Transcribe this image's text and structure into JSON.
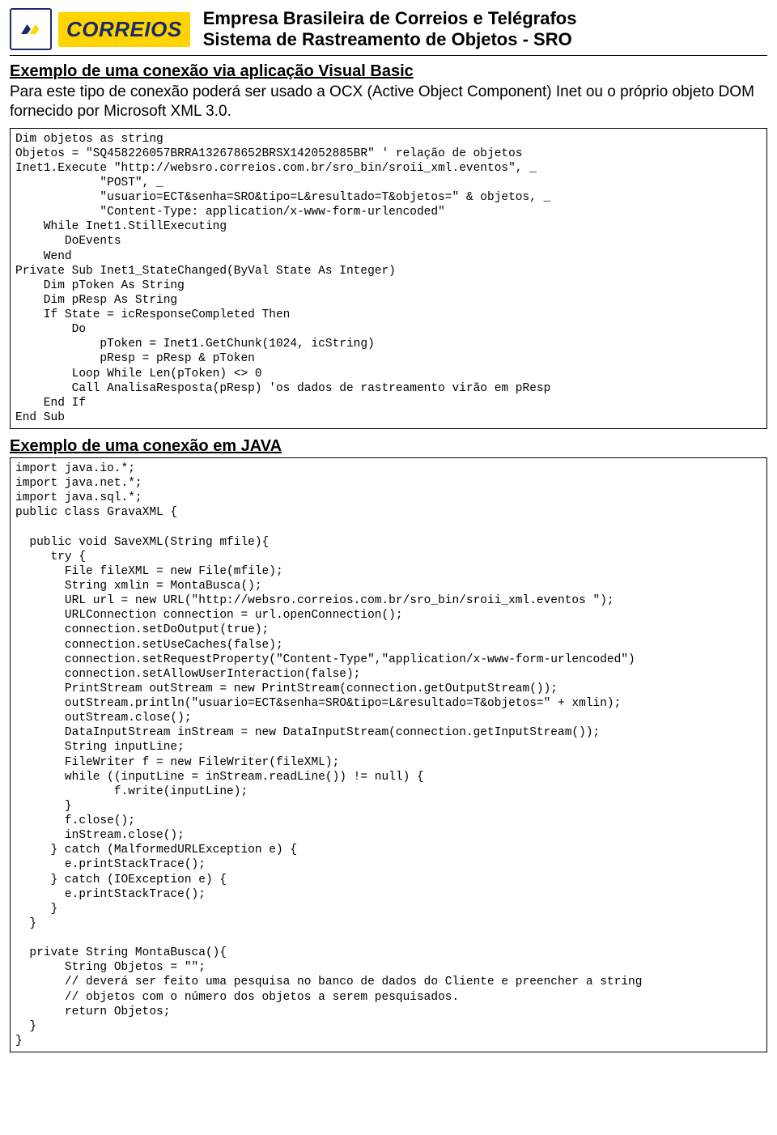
{
  "header": {
    "brand": "CORREIOS",
    "title1": "Empresa Brasileira de Correios e Telégrafos",
    "title2": "Sistema de Rastreamento de Objetos - SRO"
  },
  "section1": {
    "title": "Exemplo de uma conexão via aplicação Visual Basic",
    "intro": "Para este tipo de conexão poderá ser usado a OCX (Active Object Component) Inet ou o próprio objeto DOM fornecido por Microsoft XML 3.0.",
    "code": "Dim objetos as string\nObjetos = \"SQ458226057BRRA132678652BRSX142052885BR\" ' relação de objetos\nInet1.Execute \"http://websro.correios.com.br/sro_bin/sroii_xml.eventos\", _\n            \"POST\", _\n            \"usuario=ECT&senha=SRO&tipo=L&resultado=T&objetos=\" & objetos, _\n            \"Content-Type: application/x-www-form-urlencoded\"\n    While Inet1.StillExecuting\n       DoEvents\n    Wend\nPrivate Sub Inet1_StateChanged(ByVal State As Integer)\n    Dim pToken As String\n    Dim pResp As String\n    If State = icResponseCompleted Then\n        Do\n            pToken = Inet1.GetChunk(1024, icString)\n            pResp = pResp & pToken\n        Loop While Len(pToken) <> 0\n        Call AnalisaResposta(pResp) 'os dados de rastreamento virão em pResp\n    End If\nEnd Sub"
  },
  "section2": {
    "title": "Exemplo de uma conexão em JAVA",
    "code": "import java.io.*;\nimport java.net.*;\nimport java.sql.*;\npublic class GravaXML {\n\n  public void SaveXML(String mfile){\n     try {\n       File fileXML = new File(mfile);\n       String xmlin = MontaBusca();\n       URL url = new URL(\"http://websro.correios.com.br/sro_bin/sroii_xml.eventos \");\n       URLConnection connection = url.openConnection();\n       connection.setDoOutput(true);\n       connection.setUseCaches(false);\n       connection.setRequestProperty(\"Content-Type\",\"application/x-www-form-urlencoded\")\n       connection.setAllowUserInteraction(false);\n       PrintStream outStream = new PrintStream(connection.getOutputStream());\n       outStream.println(\"usuario=ECT&senha=SRO&tipo=L&resultado=T&objetos=\" + xmlin);\n       outStream.close();\n       DataInputStream inStream = new DataInputStream(connection.getInputStream());\n       String inputLine;\n       FileWriter f = new FileWriter(fileXML);\n       while ((inputLine = inStream.readLine()) != null) {\n              f.write(inputLine);\n       }\n       f.close();\n       inStream.close();\n     } catch (MalformedURLException e) {\n       e.printStackTrace();\n     } catch (IOException e) {\n       e.printStackTrace();\n     }\n  }\n\n  private String MontaBusca(){\n       String Objetos = \"\";\n       // deverá ser feito uma pesquisa no banco de dados do Cliente e preencher a string\n       // objetos com o número dos objetos a serem pesquisados.\n       return Objetos;\n  }\n}"
  }
}
